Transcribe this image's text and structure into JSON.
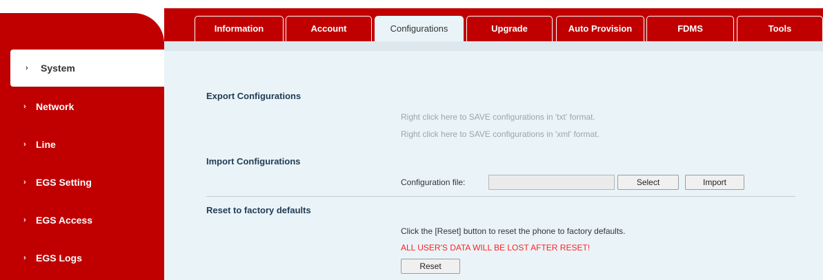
{
  "tabs": [
    {
      "label": "Information",
      "active": false
    },
    {
      "label": "Account",
      "active": false
    },
    {
      "label": "Configurations",
      "active": true
    },
    {
      "label": "Upgrade",
      "active": false
    },
    {
      "label": "Auto Provision",
      "active": false
    },
    {
      "label": "FDMS",
      "active": false
    },
    {
      "label": "Tools",
      "active": false
    }
  ],
  "sidebar": {
    "items": [
      {
        "label": "System",
        "active": true
      },
      {
        "label": "Network",
        "active": false
      },
      {
        "label": "Line",
        "active": false
      },
      {
        "label": "EGS Setting",
        "active": false
      },
      {
        "label": "EGS Access",
        "active": false
      },
      {
        "label": "EGS Logs",
        "active": false
      }
    ],
    "chevron": "›"
  },
  "export": {
    "title": "Export Configurations",
    "save_txt": "Right click here to SAVE configurations in 'txt' format.",
    "save_xml": "Right click here to SAVE configurations in 'xml' format."
  },
  "import": {
    "title": "Import Configurations",
    "file_label": "Configuration file:",
    "file_value": "",
    "select_label": "Select",
    "import_label": "Import"
  },
  "reset": {
    "title": "Reset to factory defaults",
    "description": "Click the [Reset] button to reset the phone to factory defaults.",
    "warning": "ALL USER'S DATA WILL BE LOST AFTER RESET!",
    "button_label": "Reset"
  },
  "colors": {
    "brand": "#c00000",
    "content_bg": "#eaf4f8",
    "warning": "#ff2020"
  }
}
